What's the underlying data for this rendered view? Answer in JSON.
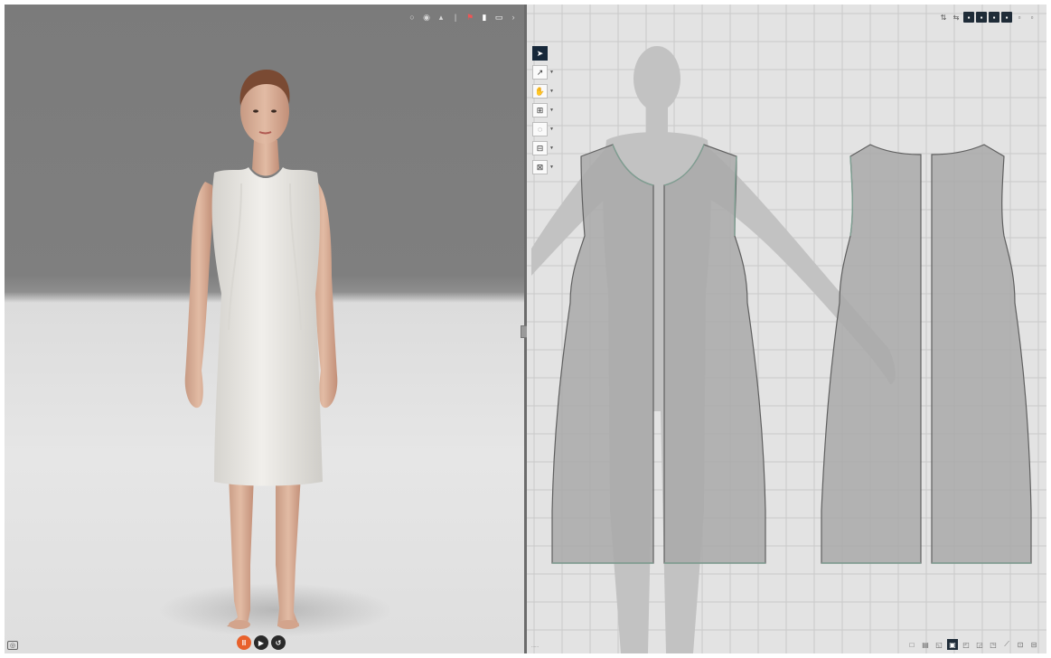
{
  "viewport_3d": {
    "toolbar_icons": [
      "circle-icon",
      "dot-icon",
      "triangle-icon",
      "flag-icon",
      "avatar-icon",
      "cube-icon",
      "display-icon",
      "chevron-icon"
    ],
    "simulation_controls": [
      {
        "icon": "pause-icon",
        "glyph": "II"
      },
      {
        "icon": "play-icon",
        "glyph": "▶"
      },
      {
        "icon": "reset-icon",
        "glyph": "↺"
      }
    ],
    "camera_icon": "◎"
  },
  "viewport_2d": {
    "tools": [
      {
        "icon": "transform-pattern-icon",
        "glyph": "➤",
        "active": true
      },
      {
        "icon": "edit-point-icon",
        "glyph": "↗",
        "active": false
      },
      {
        "icon": "fold-icon",
        "glyph": "✋",
        "active": false
      },
      {
        "icon": "segment-tape-icon",
        "glyph": "⊞",
        "active": false
      },
      {
        "icon": "circle-tool-icon",
        "glyph": "◌",
        "active": false
      },
      {
        "icon": "trace-icon",
        "glyph": "⊟",
        "active": false
      },
      {
        "icon": "measure-icon",
        "glyph": "⊠",
        "active": false
      }
    ],
    "top_toolbar_icons": [
      "arrange-icon",
      "flip-icon",
      "view-a-icon",
      "view-b-icon",
      "view-c-icon",
      "view-d-icon",
      "grid-icon",
      "layout-icon"
    ],
    "bottom_toolbar_icons": [
      "b1-icon",
      "b2-icon",
      "b3-icon",
      "b4-icon",
      "b5-icon",
      "b6-icon",
      "b7-icon",
      "b8-icon",
      "b9-icon",
      "b10-icon"
    ],
    "scale_label": "······"
  },
  "colors": {
    "sim_play": "#e8612c",
    "pattern_fill": "#a7a7a7",
    "pattern_stroke": "#7f9f92",
    "grid_line": "#c9c9c9",
    "tool_active": "#17283a"
  }
}
